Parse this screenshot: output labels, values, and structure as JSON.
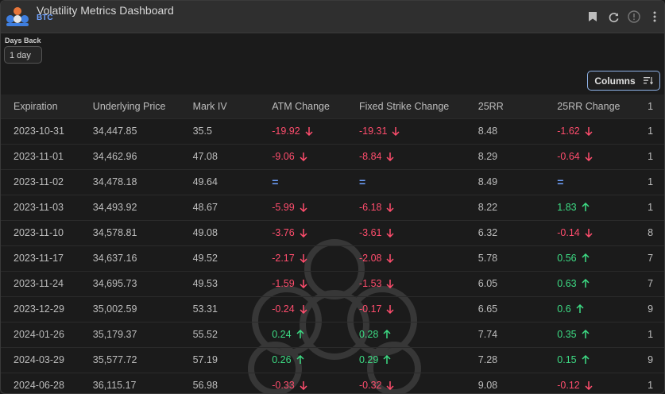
{
  "app": {
    "title": "Volatility Metrics Dashboard",
    "subtitle": "BTC"
  },
  "controls": {
    "days_back_label": "Days Back",
    "days_back_value": "1 day",
    "columns_label": "Columns"
  },
  "colors": {
    "negative": "#ff4d6d",
    "positive": "#3ddc84",
    "equal": "#6fa2ff",
    "accent": "#8fb3e8"
  },
  "table": {
    "headers": [
      "Expiration",
      "Underlying Price",
      "Mark IV",
      "ATM Change",
      "Fixed Strike Change",
      "25RR",
      "25RR Change",
      "1"
    ],
    "rows": [
      {
        "exp": "2023-10-31",
        "price": "34,447.85",
        "iv": "35.5",
        "atm": "-19.92",
        "atm_dir": "down",
        "fsc": "-19.31",
        "fsc_dir": "down",
        "rr": "8.48",
        "rrc": "-1.62",
        "rrc_dir": "down",
        "extra": "1"
      },
      {
        "exp": "2023-11-01",
        "price": "34,462.96",
        "iv": "47.08",
        "atm": "-9.06",
        "atm_dir": "down",
        "fsc": "-8.84",
        "fsc_dir": "down",
        "rr": "8.29",
        "rrc": "-0.64",
        "rrc_dir": "down",
        "extra": "1"
      },
      {
        "exp": "2023-11-02",
        "price": "34,478.18",
        "iv": "49.64",
        "atm": "=",
        "atm_dir": "eq",
        "fsc": "=",
        "fsc_dir": "eq",
        "rr": "8.49",
        "rrc": "=",
        "rrc_dir": "eq",
        "extra": "1"
      },
      {
        "exp": "2023-11-03",
        "price": "34,493.92",
        "iv": "48.67",
        "atm": "-5.99",
        "atm_dir": "down",
        "fsc": "-6.18",
        "fsc_dir": "down",
        "rr": "8.22",
        "rrc": "1.83",
        "rrc_dir": "up",
        "extra": "1"
      },
      {
        "exp": "2023-11-10",
        "price": "34,578.81",
        "iv": "49.08",
        "atm": "-3.76",
        "atm_dir": "down",
        "fsc": "-3.61",
        "fsc_dir": "down",
        "rr": "6.32",
        "rrc": "-0.14",
        "rrc_dir": "down",
        "extra": "8"
      },
      {
        "exp": "2023-11-17",
        "price": "34,637.16",
        "iv": "49.52",
        "atm": "-2.17",
        "atm_dir": "down",
        "fsc": "-2.08",
        "fsc_dir": "down",
        "rr": "5.78",
        "rrc": "0.56",
        "rrc_dir": "up",
        "extra": "7"
      },
      {
        "exp": "2023-11-24",
        "price": "34,695.73",
        "iv": "49.53",
        "atm": "-1.59",
        "atm_dir": "down",
        "fsc": "-1.53",
        "fsc_dir": "down",
        "rr": "6.05",
        "rrc": "0.63",
        "rrc_dir": "up",
        "extra": "7"
      },
      {
        "exp": "2023-12-29",
        "price": "35,002.59",
        "iv": "53.31",
        "atm": "-0.24",
        "atm_dir": "down",
        "fsc": "-0.17",
        "fsc_dir": "down",
        "rr": "6.65",
        "rrc": "0.6",
        "rrc_dir": "up",
        "extra": "9"
      },
      {
        "exp": "2024-01-26",
        "price": "35,179.37",
        "iv": "55.52",
        "atm": "0.24",
        "atm_dir": "up",
        "fsc": "0.28",
        "fsc_dir": "up",
        "rr": "7.74",
        "rrc": "0.35",
        "rrc_dir": "up",
        "extra": "1"
      },
      {
        "exp": "2024-03-29",
        "price": "35,577.72",
        "iv": "57.19",
        "atm": "0.26",
        "atm_dir": "up",
        "fsc": "0.29",
        "fsc_dir": "up",
        "rr": "7.28",
        "rrc": "0.15",
        "rrc_dir": "up",
        "extra": "9"
      },
      {
        "exp": "2024-06-28",
        "price": "36,115.17",
        "iv": "56.98",
        "atm": "-0.33",
        "atm_dir": "down",
        "fsc": "-0.32",
        "fsc_dir": "down",
        "rr": "9.08",
        "rrc": "-0.12",
        "rrc_dir": "down",
        "extra": "1"
      }
    ]
  }
}
